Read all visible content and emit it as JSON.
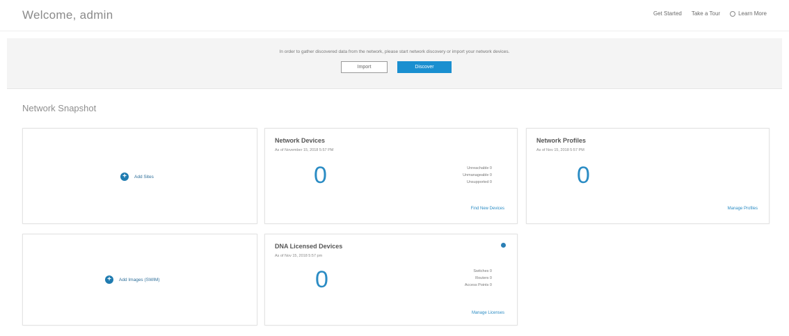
{
  "header": {
    "welcome": "Welcome, admin",
    "links": [
      "Get Started",
      "Take a Tour",
      "Learn More"
    ]
  },
  "banner": {
    "message": "In order to gather discovered data from the network, please start network discovery or import your network devices.",
    "import_label": "Import",
    "discover_label": "Discover"
  },
  "snapshot": {
    "title": "Network Snapshot",
    "add_sites_label": "Add Sites",
    "add_images_label": "Add Images (SWIM)",
    "network_devices": {
      "title": "Network Devices",
      "subtitle": "As of November 15, 2018 5:57 PM",
      "count": "0",
      "stats": [
        "Unreachable  0",
        "Unmanageable  0",
        "Unsupported  0"
      ],
      "link": "Find New Devices"
    },
    "network_profiles": {
      "title": "Network Profiles",
      "subtitle": "As of Nov 15, 2018 5:57 PM",
      "count": "0",
      "link": "Manage Profiles"
    },
    "dna_licensed": {
      "title": "DNA Licensed Devices",
      "subtitle": "As of Nov 15, 2018 5:57 pm",
      "count": "0",
      "stats": [
        "Switches  0",
        "Routers  0",
        "Access Points  0"
      ],
      "link": "Manage Licenses"
    }
  },
  "colors": {
    "accent": "#1a8fd0",
    "plus": "#1f7bb0"
  },
  "icons": {
    "learn": "info-circle-icon",
    "add": "plus-circle-icon",
    "status": "status-dot-icon"
  }
}
